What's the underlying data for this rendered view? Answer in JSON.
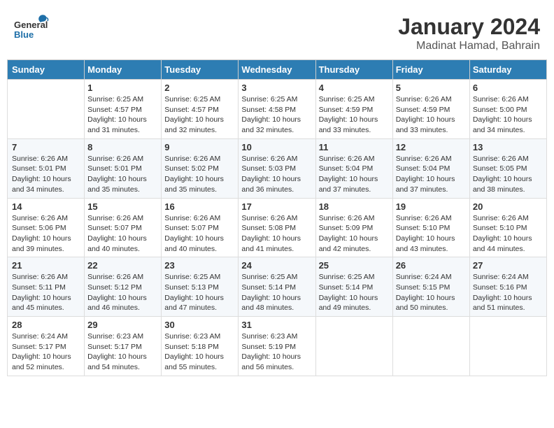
{
  "header": {
    "logo_general": "General",
    "logo_blue": "Blue",
    "month_year": "January 2024",
    "location": "Madinat Hamad, Bahrain"
  },
  "days_of_week": [
    "Sunday",
    "Monday",
    "Tuesday",
    "Wednesday",
    "Thursday",
    "Friday",
    "Saturday"
  ],
  "weeks": [
    [
      {
        "day": "",
        "info": ""
      },
      {
        "day": "1",
        "info": "Sunrise: 6:25 AM\nSunset: 4:57 PM\nDaylight: 10 hours\nand 31 minutes."
      },
      {
        "day": "2",
        "info": "Sunrise: 6:25 AM\nSunset: 4:57 PM\nDaylight: 10 hours\nand 32 minutes."
      },
      {
        "day": "3",
        "info": "Sunrise: 6:25 AM\nSunset: 4:58 PM\nDaylight: 10 hours\nand 32 minutes."
      },
      {
        "day": "4",
        "info": "Sunrise: 6:25 AM\nSunset: 4:59 PM\nDaylight: 10 hours\nand 33 minutes."
      },
      {
        "day": "5",
        "info": "Sunrise: 6:26 AM\nSunset: 4:59 PM\nDaylight: 10 hours\nand 33 minutes."
      },
      {
        "day": "6",
        "info": "Sunrise: 6:26 AM\nSunset: 5:00 PM\nDaylight: 10 hours\nand 34 minutes."
      }
    ],
    [
      {
        "day": "7",
        "info": "Sunrise: 6:26 AM\nSunset: 5:01 PM\nDaylight: 10 hours\nand 34 minutes."
      },
      {
        "day": "8",
        "info": "Sunrise: 6:26 AM\nSunset: 5:01 PM\nDaylight: 10 hours\nand 35 minutes."
      },
      {
        "day": "9",
        "info": "Sunrise: 6:26 AM\nSunset: 5:02 PM\nDaylight: 10 hours\nand 35 minutes."
      },
      {
        "day": "10",
        "info": "Sunrise: 6:26 AM\nSunset: 5:03 PM\nDaylight: 10 hours\nand 36 minutes."
      },
      {
        "day": "11",
        "info": "Sunrise: 6:26 AM\nSunset: 5:04 PM\nDaylight: 10 hours\nand 37 minutes."
      },
      {
        "day": "12",
        "info": "Sunrise: 6:26 AM\nSunset: 5:04 PM\nDaylight: 10 hours\nand 37 minutes."
      },
      {
        "day": "13",
        "info": "Sunrise: 6:26 AM\nSunset: 5:05 PM\nDaylight: 10 hours\nand 38 minutes."
      }
    ],
    [
      {
        "day": "14",
        "info": "Sunrise: 6:26 AM\nSunset: 5:06 PM\nDaylight: 10 hours\nand 39 minutes."
      },
      {
        "day": "15",
        "info": "Sunrise: 6:26 AM\nSunset: 5:07 PM\nDaylight: 10 hours\nand 40 minutes."
      },
      {
        "day": "16",
        "info": "Sunrise: 6:26 AM\nSunset: 5:07 PM\nDaylight: 10 hours\nand 40 minutes."
      },
      {
        "day": "17",
        "info": "Sunrise: 6:26 AM\nSunset: 5:08 PM\nDaylight: 10 hours\nand 41 minutes."
      },
      {
        "day": "18",
        "info": "Sunrise: 6:26 AM\nSunset: 5:09 PM\nDaylight: 10 hours\nand 42 minutes."
      },
      {
        "day": "19",
        "info": "Sunrise: 6:26 AM\nSunset: 5:10 PM\nDaylight: 10 hours\nand 43 minutes."
      },
      {
        "day": "20",
        "info": "Sunrise: 6:26 AM\nSunset: 5:10 PM\nDaylight: 10 hours\nand 44 minutes."
      }
    ],
    [
      {
        "day": "21",
        "info": "Sunrise: 6:26 AM\nSunset: 5:11 PM\nDaylight: 10 hours\nand 45 minutes."
      },
      {
        "day": "22",
        "info": "Sunrise: 6:26 AM\nSunset: 5:12 PM\nDaylight: 10 hours\nand 46 minutes."
      },
      {
        "day": "23",
        "info": "Sunrise: 6:25 AM\nSunset: 5:13 PM\nDaylight: 10 hours\nand 47 minutes."
      },
      {
        "day": "24",
        "info": "Sunrise: 6:25 AM\nSunset: 5:14 PM\nDaylight: 10 hours\nand 48 minutes."
      },
      {
        "day": "25",
        "info": "Sunrise: 6:25 AM\nSunset: 5:14 PM\nDaylight: 10 hours\nand 49 minutes."
      },
      {
        "day": "26",
        "info": "Sunrise: 6:24 AM\nSunset: 5:15 PM\nDaylight: 10 hours\nand 50 minutes."
      },
      {
        "day": "27",
        "info": "Sunrise: 6:24 AM\nSunset: 5:16 PM\nDaylight: 10 hours\nand 51 minutes."
      }
    ],
    [
      {
        "day": "28",
        "info": "Sunrise: 6:24 AM\nSunset: 5:17 PM\nDaylight: 10 hours\nand 52 minutes."
      },
      {
        "day": "29",
        "info": "Sunrise: 6:23 AM\nSunset: 5:17 PM\nDaylight: 10 hours\nand 54 minutes."
      },
      {
        "day": "30",
        "info": "Sunrise: 6:23 AM\nSunset: 5:18 PM\nDaylight: 10 hours\nand 55 minutes."
      },
      {
        "day": "31",
        "info": "Sunrise: 6:23 AM\nSunset: 5:19 PM\nDaylight: 10 hours\nand 56 minutes."
      },
      {
        "day": "",
        "info": ""
      },
      {
        "day": "",
        "info": ""
      },
      {
        "day": "",
        "info": ""
      }
    ]
  ]
}
